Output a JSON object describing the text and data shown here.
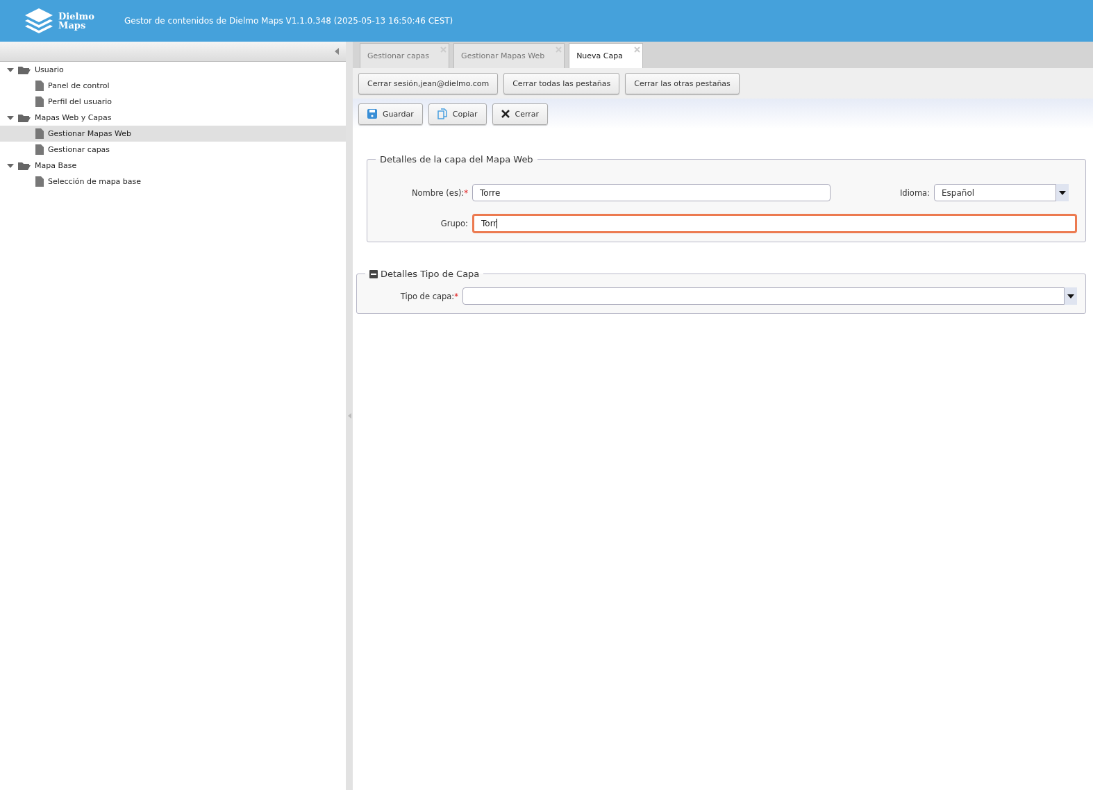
{
  "header": {
    "logo_lines": [
      "Dielmo",
      "Maps"
    ],
    "title": "Gestor de contenidos de Dielmo Maps V1.1.0.348 (2025-05-13 16:50:46 CEST)"
  },
  "sidebar": {
    "expanded": true,
    "tree": [
      {
        "label": "Usuario",
        "expanded": true,
        "selected": false,
        "children": [
          {
            "label": "Panel de control",
            "selected": false
          },
          {
            "label": "Perfil del usuario",
            "selected": false
          }
        ]
      },
      {
        "label": "Mapas Web y Capas",
        "expanded": true,
        "selected": false,
        "children": [
          {
            "label": "Gestionar Mapas Web",
            "selected": true
          },
          {
            "label": "Gestionar capas",
            "selected": false
          }
        ]
      },
      {
        "label": "Mapa Base",
        "expanded": true,
        "selected": false,
        "children": [
          {
            "label": "Selección de mapa base",
            "selected": false
          }
        ]
      }
    ]
  },
  "tabs": [
    {
      "label": "Gestionar capas",
      "selected": false
    },
    {
      "label": "Gestionar Mapas Web",
      "selected": false
    },
    {
      "label": "Nueva Capa",
      "selected": true
    }
  ],
  "session_buttons": [
    "Cerrar sesión,jean@dielmo.com",
    "Cerrar todas las pestañas",
    "Cerrar las otras pestañas"
  ],
  "actions": [
    {
      "kind": "save",
      "label": "Guardar"
    },
    {
      "kind": "copy",
      "label": "Copiar"
    },
    {
      "kind": "close",
      "label": "Cerrar"
    }
  ],
  "details": {
    "legend": "Detalles de la capa del Mapa Web",
    "name": {
      "label": "Nombre (es):",
      "required_mark": "*",
      "value": "Torre",
      "focused": false
    },
    "language": {
      "label": "Idioma:",
      "value": "Español"
    },
    "group": {
      "label": "Grupo:",
      "value": "Torr",
      "focused": true
    }
  },
  "type_section": {
    "legend": "Detalles Tipo de Capa",
    "expanded": true,
    "type": {
      "label": "Tipo de capa:",
      "required_mark": "*"
    }
  }
}
